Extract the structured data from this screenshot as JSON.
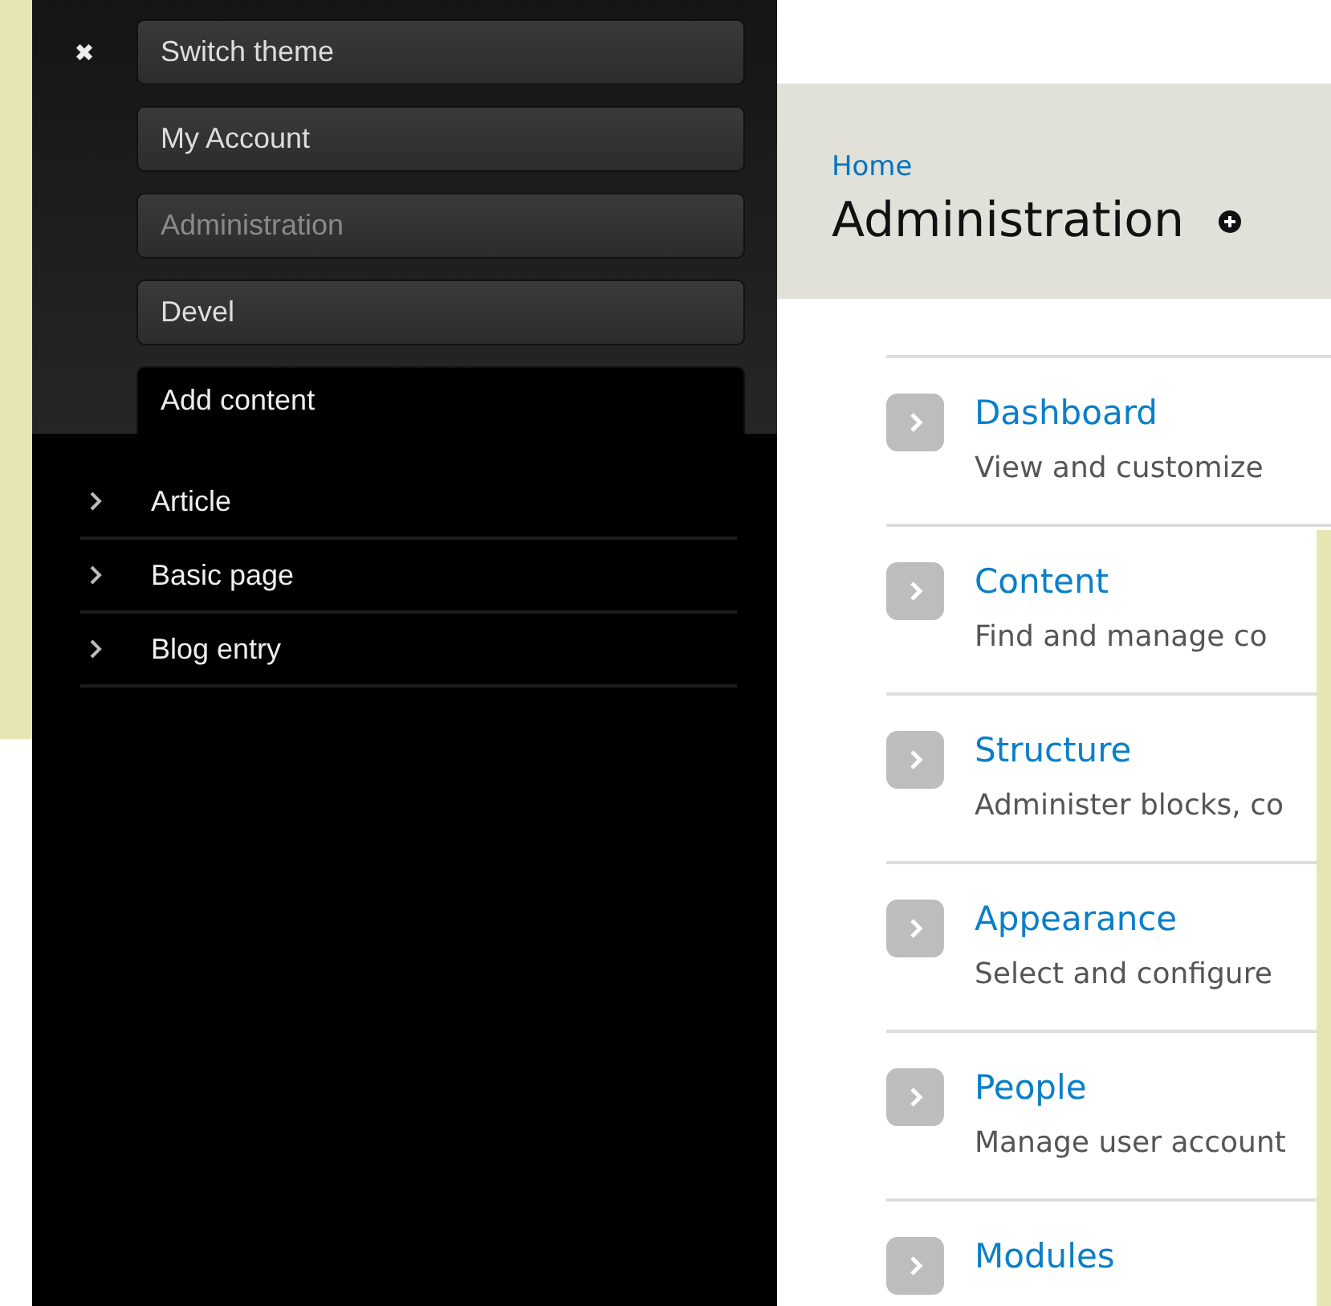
{
  "toolbar": {
    "close_icon": "✖",
    "tabs": [
      {
        "label": "Switch theme",
        "selected": false,
        "disabled": false
      },
      {
        "label": "My Account",
        "selected": false,
        "disabled": false
      },
      {
        "label": "Administration",
        "selected": false,
        "disabled": true
      },
      {
        "label": "Devel",
        "selected": false,
        "disabled": false
      },
      {
        "label": "Add content",
        "selected": true,
        "disabled": false
      }
    ],
    "items": [
      {
        "label": "Article"
      },
      {
        "label": "Basic page"
      },
      {
        "label": "Blog entry"
      }
    ]
  },
  "header": {
    "breadcrumb": "Home",
    "title": "Administration"
  },
  "sections": [
    {
      "title": "Dashboard",
      "description": "View and customize"
    },
    {
      "title": "Content",
      "description": "Find and manage co"
    },
    {
      "title": "Structure",
      "description": "Administer blocks, co"
    },
    {
      "title": "Appearance",
      "description": "Select and configure"
    },
    {
      "title": "People",
      "description": "Manage user account"
    },
    {
      "title": "Modules"
    }
  ]
}
